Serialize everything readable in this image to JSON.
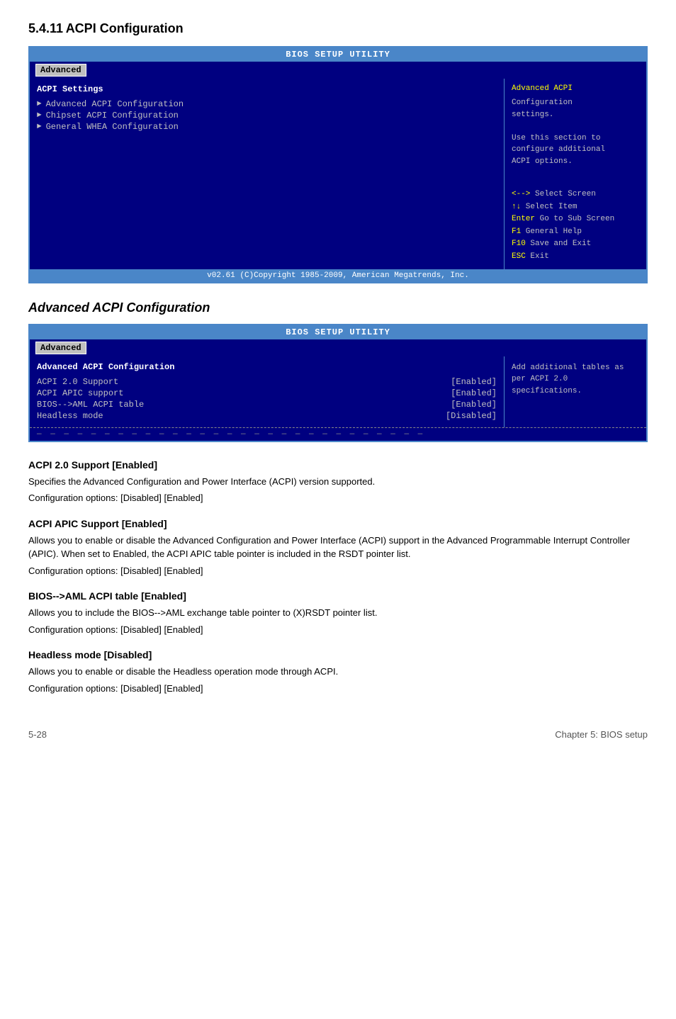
{
  "page": {
    "section_number": "5.4.11",
    "section_title": "ACPI Configuration",
    "footer_left": "5-28",
    "footer_right": "Chapter 5: BIOS setup"
  },
  "bios_screen_1": {
    "header": "BIOS SETUP UTILITY",
    "tab_label": "Advanced",
    "left_section_label": "ACPI Settings",
    "menu_items": [
      "Advanced ACPI Configuration",
      "Chipset ACPI Configuration",
      "General WHEA Configuration"
    ],
    "right_help_title": "Advanced ACPI",
    "right_help_text": "Configuration\nsettings.\n\nUse this section to\nconfigure additional\nACPI options.",
    "keys": [
      {
        "key": "<-->",
        "desc": "Select Screen"
      },
      {
        "key": "↑↓",
        "desc": "Select Item"
      },
      {
        "key": "Enter",
        "desc": "Go to Sub Screen"
      },
      {
        "key": "F1",
        "desc": "General Help"
      },
      {
        "key": "F10",
        "desc": "Save and Exit"
      },
      {
        "key": "ESC",
        "desc": "Exit"
      }
    ],
    "footer": "v02.61  (C)Copyright 1985-2009, American Megatrends, Inc."
  },
  "subsection_title": "Advanced ACPI Configuration",
  "bios_screen_2": {
    "header": "BIOS SETUP UTILITY",
    "tab_label": "Advanced",
    "left_section_label": "Advanced ACPI Configuration",
    "settings": [
      {
        "label": "ACPI 2.0 Support",
        "value": "[Enabled]"
      },
      {
        "label": "ACPI APIC support",
        "value": "[Enabled]"
      },
      {
        "label": "BIOS-->AML ACPI table",
        "value": "[Enabled]"
      },
      {
        "label": "Headless mode",
        "value": "[Disabled]"
      }
    ],
    "right_help_text": "Add additional tables\nas per ACPI 2.0\nspecifications."
  },
  "content": {
    "sections": [
      {
        "heading": "ACPI 2.0 Support [Enabled]",
        "paragraphs": [
          "Specifies the Advanced Configuration and Power Interface (ACPI) version supported.",
          "Configuration options: [Disabled] [Enabled]"
        ]
      },
      {
        "heading": "ACPI APIC Support [Enabled]",
        "paragraphs": [
          "Allows you to enable or disable the Advanced Configuration and Power Interface (ACPI) support in the Advanced Programmable Interrupt Controller (APIC). When set to Enabled, the ACPI APIC table pointer is included in the RSDT pointer list.",
          "Configuration options: [Disabled] [Enabled]"
        ]
      },
      {
        "heading": "BIOS-->AML ACPI table [Enabled]",
        "paragraphs": [
          "Allows you to include the BIOS-->AML exchange table pointer to (X)RSDT pointer list.",
          "Configuration options: [Disabled] [Enabled]"
        ]
      },
      {
        "heading": "Headless mode [Disabled]",
        "paragraphs": [
          "Allows you to enable or disable the Headless operation mode through ACPI.",
          "Configuration options: [Disabled] [Enabled]"
        ]
      }
    ]
  }
}
